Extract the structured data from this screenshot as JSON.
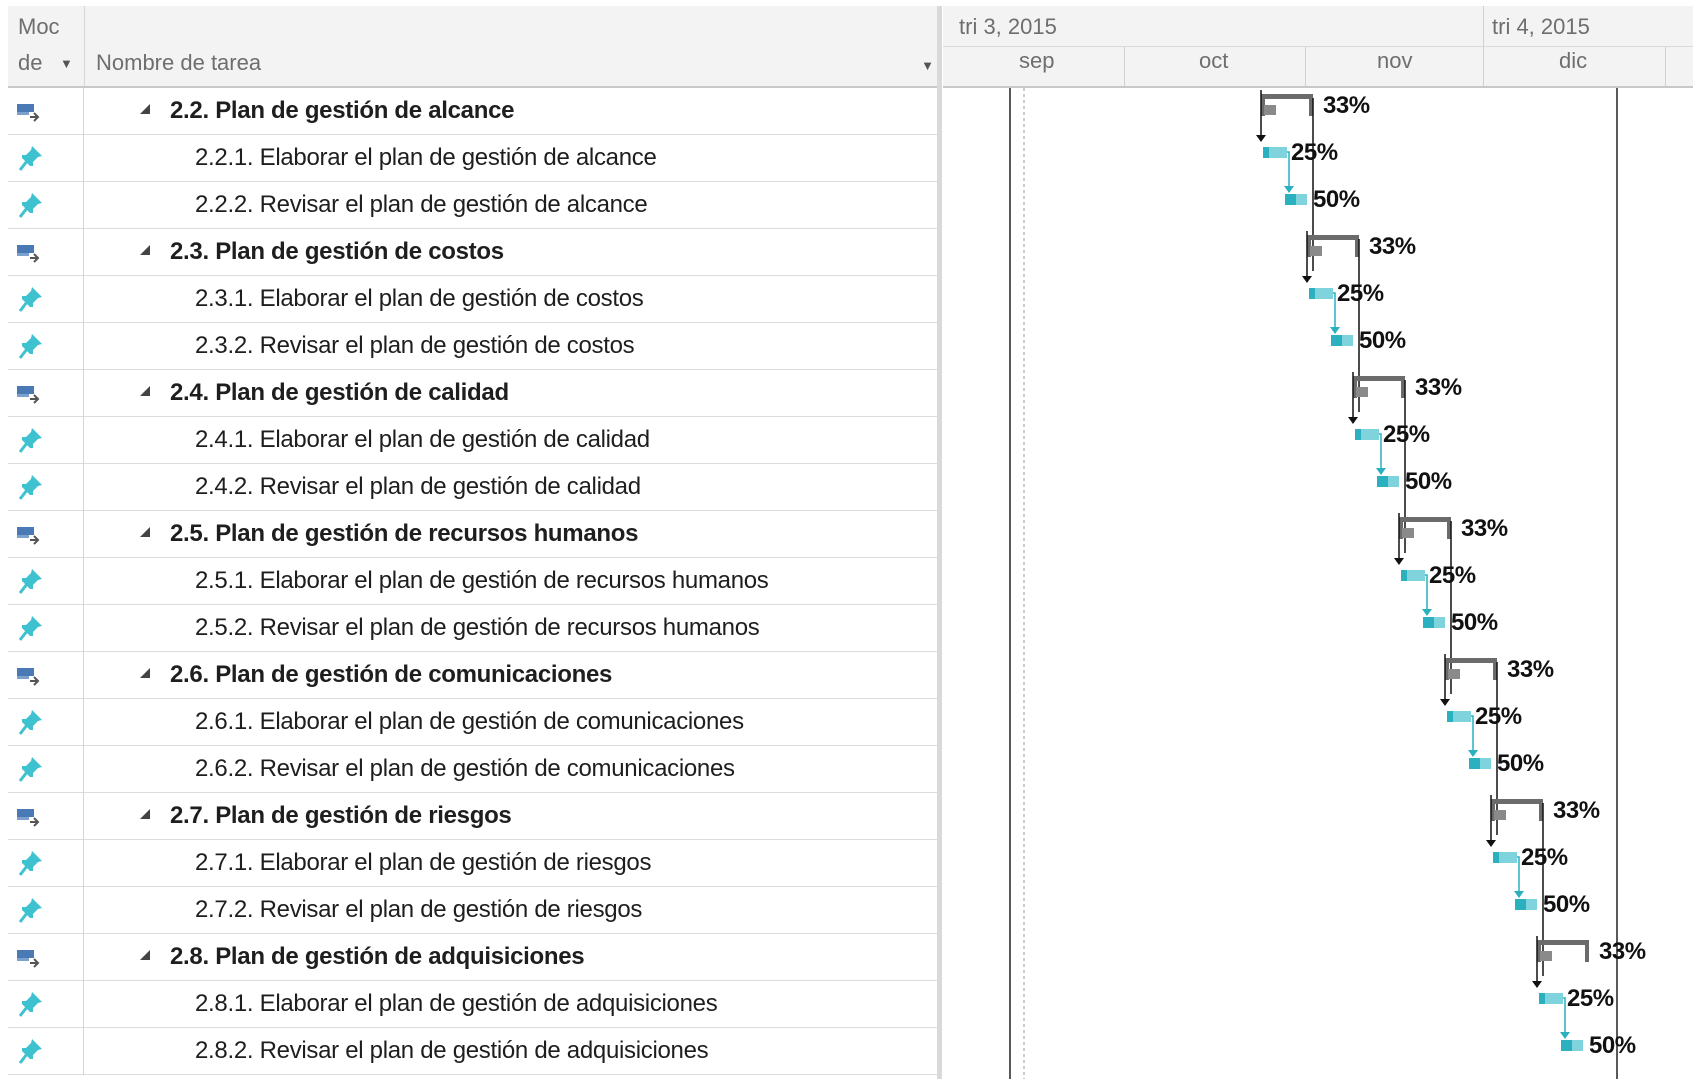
{
  "header": {
    "mode_col_line1": "Moc",
    "mode_col_line2": "de",
    "name_col": "Nombre de tarea"
  },
  "timescale": {
    "quarters": [
      "tri 3, 2015",
      "tri 4, 2015"
    ],
    "months": [
      "sep",
      "oct",
      "nov",
      "dic"
    ]
  },
  "tasks": [
    {
      "type": "summary",
      "icon": "auto-scheduled-summary-icon",
      "name": "2.2. Plan de gestión de alcance",
      "pct": "33%"
    },
    {
      "type": "task",
      "icon": "manual-pin-icon",
      "name": "2.2.1. Elaborar el plan de gestión de alcance",
      "pct": "25%"
    },
    {
      "type": "task",
      "icon": "manual-pin-icon",
      "name": "2.2.2. Revisar el plan de gestión de alcance",
      "pct": "50%"
    },
    {
      "type": "summary",
      "icon": "auto-scheduled-summary-icon",
      "name": "2.3. Plan de gestión de costos",
      "pct": "33%"
    },
    {
      "type": "task",
      "icon": "manual-pin-icon",
      "name": "2.3.1. Elaborar el plan de gestión de costos",
      "pct": "25%"
    },
    {
      "type": "task",
      "icon": "manual-pin-icon",
      "name": "2.3.2. Revisar el plan de gestión de costos",
      "pct": "50%"
    },
    {
      "type": "summary",
      "icon": "auto-scheduled-summary-icon",
      "name": "2.4. Plan de gestión de calidad",
      "pct": "33%"
    },
    {
      "type": "task",
      "icon": "manual-pin-icon",
      "name": "2.4.1. Elaborar el plan de gestión de calidad",
      "pct": "25%"
    },
    {
      "type": "task",
      "icon": "manual-pin-icon",
      "name": "2.4.2. Revisar el plan de gestión de calidad",
      "pct": "50%"
    },
    {
      "type": "summary",
      "icon": "auto-scheduled-summary-icon",
      "name": "2.5. Plan de gestión de recursos humanos",
      "pct": "33%"
    },
    {
      "type": "task",
      "icon": "manual-pin-icon",
      "name": "2.5.1. Elaborar el plan de gestión de recursos humanos",
      "pct": "25%"
    },
    {
      "type": "task",
      "icon": "manual-pin-icon",
      "name": "2.5.2. Revisar el plan de gestión de recursos humanos",
      "pct": "50%"
    },
    {
      "type": "summary",
      "icon": "auto-scheduled-summary-icon",
      "name": "2.6. Plan de gestión de comunicaciones",
      "pct": "33%"
    },
    {
      "type": "task",
      "icon": "manual-pin-icon",
      "name": "2.6.1. Elaborar el plan de gestión de comunicaciones",
      "pct": "25%"
    },
    {
      "type": "task",
      "icon": "manual-pin-icon",
      "name": "2.6.2. Revisar el plan de gestión de comunicaciones",
      "pct": "50%"
    },
    {
      "type": "summary",
      "icon": "auto-scheduled-summary-icon",
      "name": "2.7. Plan de gestión de riesgos",
      "pct": "33%"
    },
    {
      "type": "task",
      "icon": "manual-pin-icon",
      "name": "2.7.1. Elaborar el plan de gestión de riesgos",
      "pct": "25%"
    },
    {
      "type": "task",
      "icon": "manual-pin-icon",
      "name": "2.7.2. Revisar el plan de gestión de riesgos",
      "pct": "50%"
    },
    {
      "type": "summary",
      "icon": "auto-scheduled-summary-icon",
      "name": "2.8. Plan de gestión de adquisiciones",
      "pct": "33%"
    },
    {
      "type": "task",
      "icon": "manual-pin-icon",
      "name": "2.8.1. Elaborar el plan de gestión de adquisiciones",
      "pct": "25%"
    },
    {
      "type": "task",
      "icon": "manual-pin-icon",
      "name": "2.8.2. Revisar el plan de gestión de adquisiciones",
      "pct": "50%"
    }
  ],
  "colors": {
    "summary_bar": "#6b6b6b",
    "task_bar": "#7fd3dc",
    "task_progress": "#2bb0c0",
    "link_line": "#111111",
    "task_link": "#2bb0c0",
    "summary_icon": "#4a7ab5",
    "pin_icon": "#3fc2d0"
  }
}
